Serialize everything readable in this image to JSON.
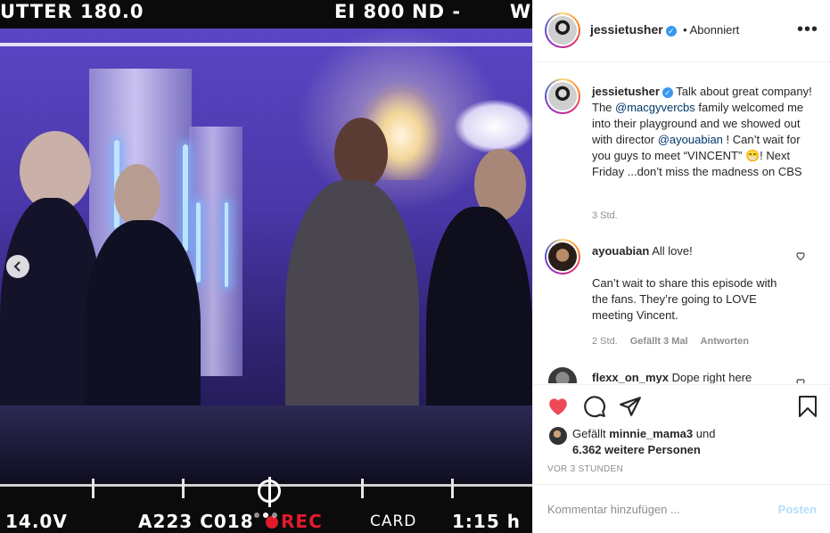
{
  "photo": {
    "hud_top": {
      "shutter": "UTTER 180.0",
      "ei": "EI 800",
      "nd": "ND -",
      "wb": "WB"
    },
    "hud_bottom": {
      "voltage": "14.0V",
      "clip": "A223 C018",
      "rec": "REC",
      "media": "CARD",
      "remaining": "1:15 h"
    },
    "carousel_dots": 3,
    "carousel_active": 1,
    "prev_icon": "chevron-left-icon"
  },
  "header": {
    "username": "jessietusher",
    "follow_status": "• Abonniert",
    "more_icon": "more-horizontal-icon"
  },
  "caption": {
    "username": "jessietusher",
    "text_1": "Talk about great company! The ",
    "mention_1": "@macgyvercbs",
    "text_2": " family welcomed me into their playground and we showed out with director ",
    "mention_2": "@ayouabian",
    "text_3": " ! Can’t wait for you guys to meet “VINCENT” 😁! Next Friday ...don’t miss the madness on CBS",
    "time": "3 Std."
  },
  "comments": [
    {
      "username": "ayouabian",
      "text_line1": "All love!",
      "text_body": "Can’t wait to share this episode with the fans. They’re going to LOVE meeting Vincent.",
      "time": "2 Std.",
      "likes": "Gefällt 3 Mal",
      "reply": "Antworten"
    },
    {
      "username": "flexx_on_myx",
      "text_line1": "Dope right here"
    }
  ],
  "likes": {
    "prefix": "Gefällt ",
    "user": "minnie_mama3",
    "mid": " und",
    "others": "6.362 weitere Personen"
  },
  "timestamp": "VOR 3 STUNDEN",
  "add_comment": {
    "placeholder": "Kommentar hinzufügen ...",
    "post": "Posten"
  },
  "colors": {
    "like_red": "#ed4956",
    "link": "#00376b",
    "verified": "#3897f0",
    "post_disabled": "#b2dffc"
  }
}
